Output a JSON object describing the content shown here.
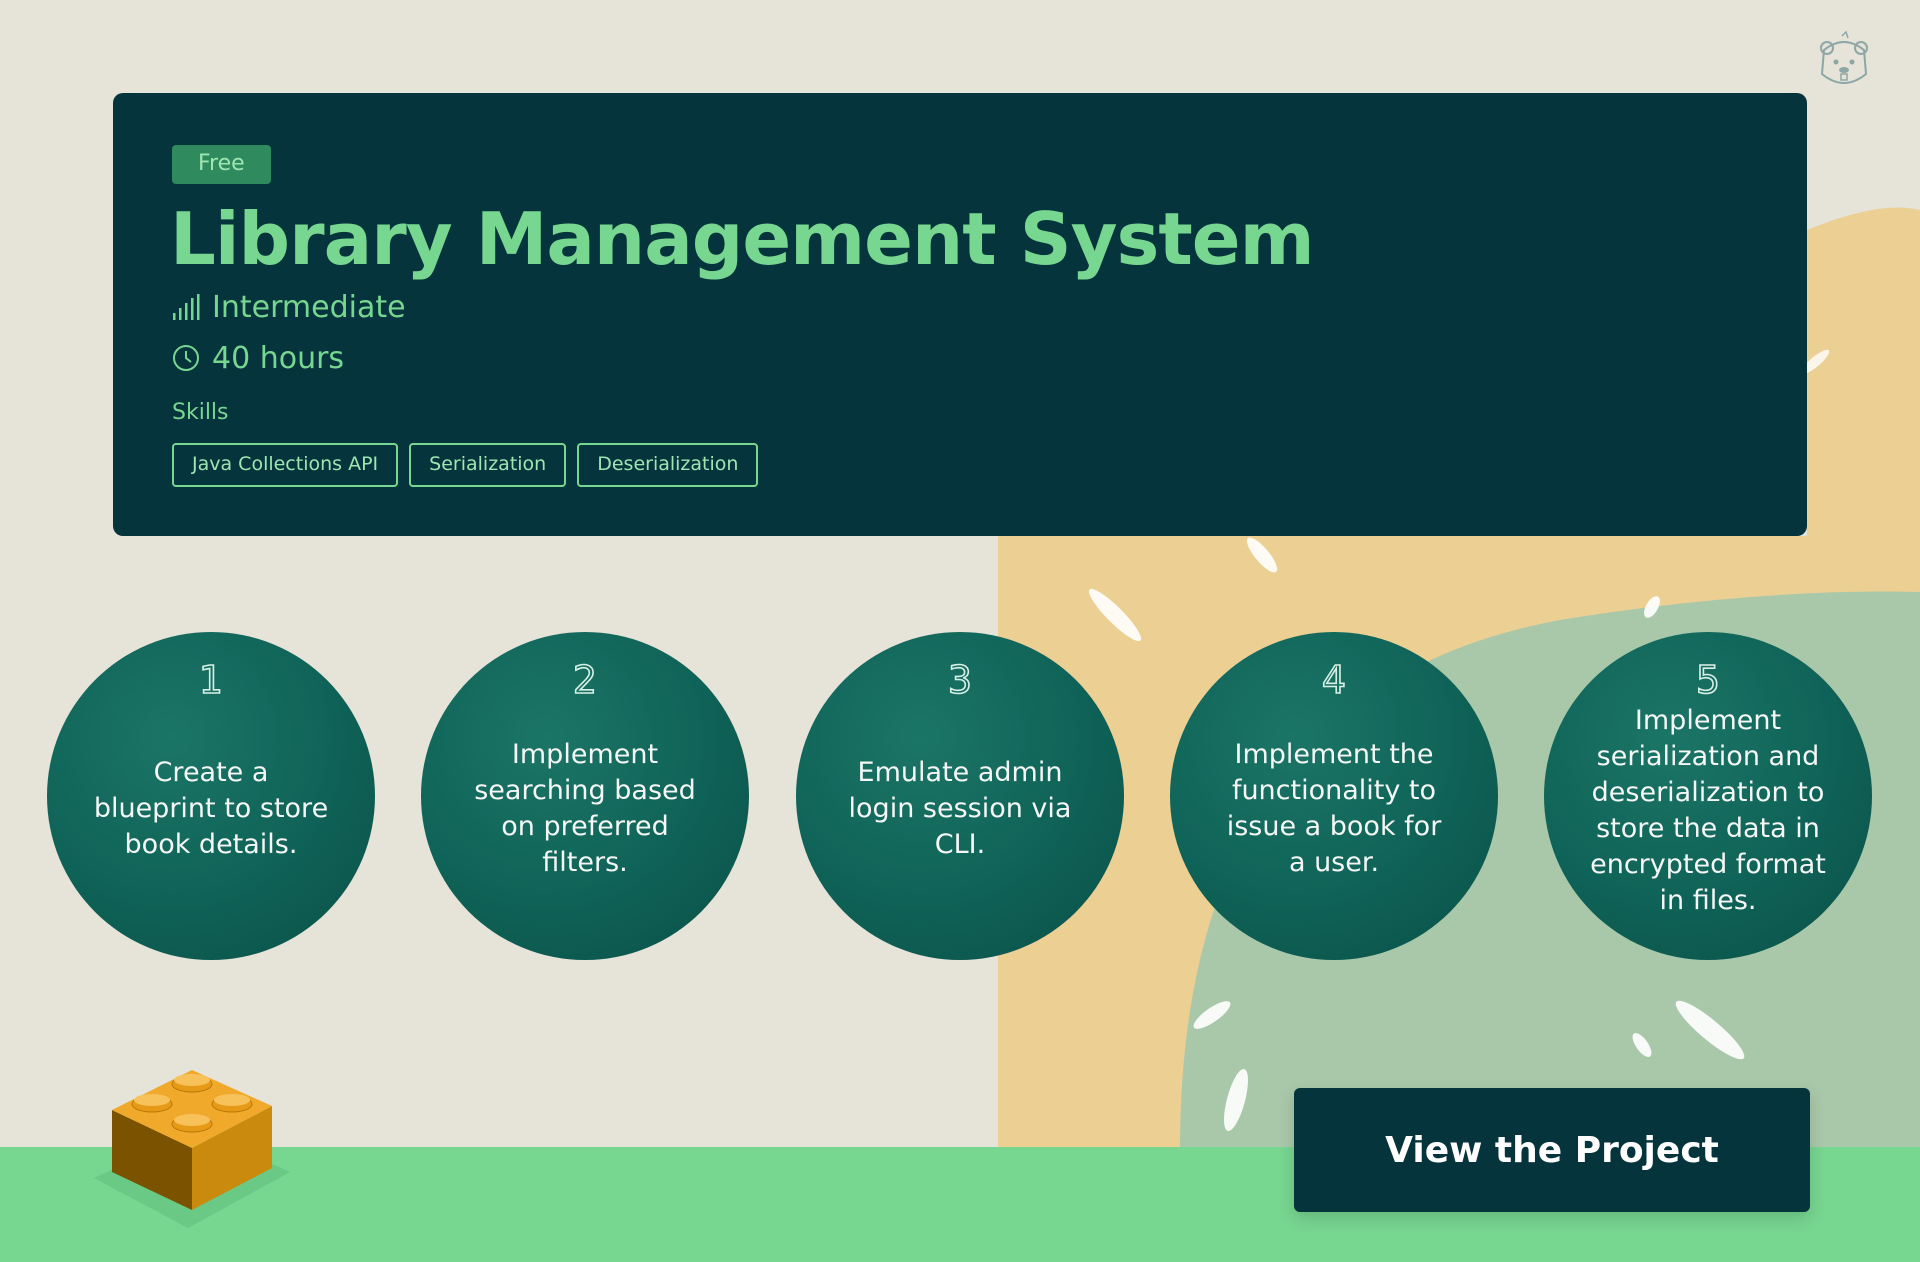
{
  "project": {
    "badge": "Free",
    "title": "Library Management System",
    "level": "Intermediate",
    "duration": "40 hours",
    "skills_label": "Skills",
    "skills": [
      "Java Collections API",
      "Serialization",
      "Deserialization"
    ]
  },
  "steps": [
    {
      "num": "1",
      "text": "Create a blueprint to store book details."
    },
    {
      "num": "2",
      "text": "Implement searching based on preferred filters."
    },
    {
      "num": "3",
      "text": "Emulate admin login session via CLI."
    },
    {
      "num": "4",
      "text": "Implement the functionality to issue a book for a user."
    },
    {
      "num": "5",
      "text": "Implement serialization and deserialization to store the data in encrypted format in files."
    }
  ],
  "cta": {
    "label": "View the Project"
  },
  "icons": {
    "level": "signal-bars-icon",
    "duration": "clock-icon",
    "mascot": "beaver-logo-icon",
    "decoration": "lego-brick-icon"
  },
  "colors": {
    "card_bg": "#05343c",
    "accent_green": "#77d690",
    "step_circle": "#0f6257",
    "page_bg": "#e6e3d8",
    "sand": "#ebcf93",
    "sage": "#a9c8aa"
  }
}
